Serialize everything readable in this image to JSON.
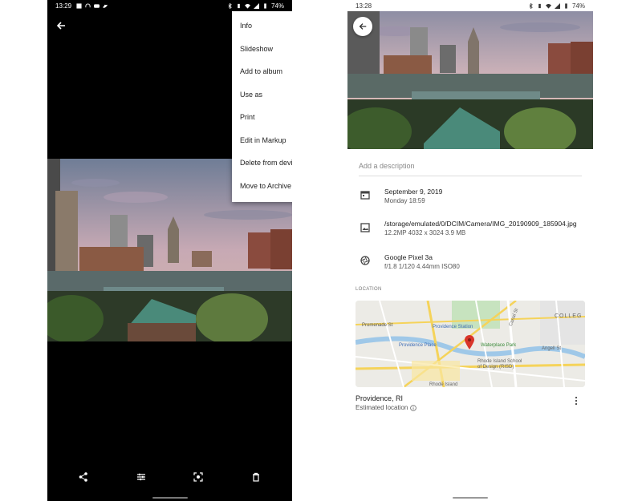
{
  "left_screen": {
    "status": {
      "time": "13:29",
      "battery": "74%"
    },
    "menu": [
      "Info",
      "Slideshow",
      "Add to album",
      "Use as",
      "Print",
      "Edit in Markup",
      "Delete from device",
      "Move to Archive"
    ],
    "bottom_actions": [
      "share-icon",
      "edit-icon",
      "lens-icon",
      "delete-icon"
    ]
  },
  "right_screen": {
    "status": {
      "time": "13:28",
      "battery": "74%"
    },
    "description_placeholder": "Add a description",
    "date": {
      "line1": "September 9, 2019",
      "line2": "Monday 18:59"
    },
    "file": {
      "path": "/storage/emulated/0/DCIM/Camera/IMG_20190909_185904.jpg",
      "details": "12.2MP    4032 x 3024    3.9 MB"
    },
    "camera": {
      "model": "Google Pixel 3a",
      "details": "f/1.8    1/120    4.44mm    ISO80"
    },
    "location_heading": "LOCATION",
    "map_labels": {
      "providence_station": "Providence Station",
      "providence_place": "Providence Place",
      "waterplace_park": "Waterplace Park",
      "risd": "Rhode Island School of Design (RISD)",
      "college": "COLLEG",
      "promenade": "Promenade St",
      "angell": "Angell St",
      "canal": "Canal St",
      "rhode_island": "Rhode Island"
    },
    "location_name": "Providence, RI",
    "location_sub": "Estimated location"
  },
  "colors": {
    "accent_pin": "#d9352a",
    "map_water": "#9fc8e8",
    "map_road": "#f5d35a",
    "sky": "#b8a8b8"
  }
}
